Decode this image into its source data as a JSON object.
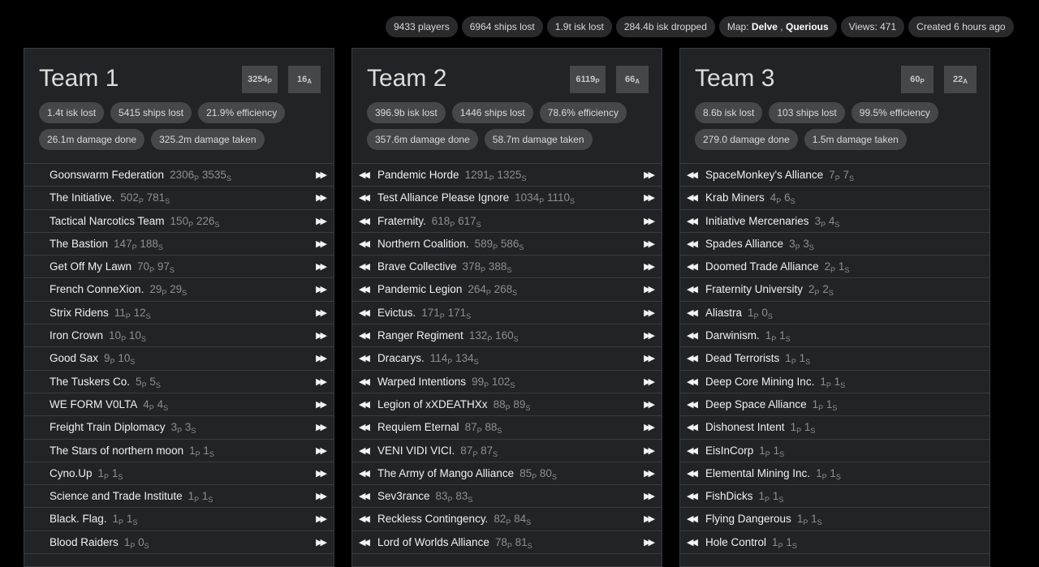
{
  "header": {
    "players": "9433 players",
    "ships_lost": "6964 ships lost",
    "isk_lost": "1.9t isk lost",
    "isk_dropped": "284.4b isk dropped",
    "map_label": "Map:",
    "map_system_1": "Delve",
    "map_sep": ",",
    "map_system_2": "Querious",
    "views": "Views: 471",
    "created": "Created 6 hours ago"
  },
  "teams": [
    {
      "title": "Team 1",
      "pilots": "3254",
      "pilot_sub": "P",
      "alliances": "16",
      "alliance_sub": "A",
      "stats": [
        "1.4t isk lost",
        "5415 ships lost",
        "21.9% efficiency",
        "26.1m damage done",
        "325.2m damage taken"
      ],
      "rows": [
        {
          "name": "Goonswarm Federation",
          "p": "2306",
          "s": "3535"
        },
        {
          "name": "The Initiative.",
          "p": "502",
          "s": "781"
        },
        {
          "name": "Tactical Narcotics Team",
          "p": "150",
          "s": "226"
        },
        {
          "name": "The Bastion",
          "p": "147",
          "s": "188"
        },
        {
          "name": "Get Off My Lawn",
          "p": "70",
          "s": "97"
        },
        {
          "name": "French ConneXion.",
          "p": "29",
          "s": "29"
        },
        {
          "name": "Strix Ridens",
          "p": "11",
          "s": "12"
        },
        {
          "name": "Iron Crown",
          "p": "10",
          "s": "10"
        },
        {
          "name": "Good Sax",
          "p": "9",
          "s": "10"
        },
        {
          "name": "The Tuskers Co.",
          "p": "5",
          "s": "5"
        },
        {
          "name": "WE FORM V0LTA",
          "p": "4",
          "s": "4"
        },
        {
          "name": "Freight Train Diplomacy",
          "p": "3",
          "s": "3"
        },
        {
          "name": "The Stars of northern moon",
          "p": "1",
          "s": "1"
        },
        {
          "name": "Cyno.Up",
          "p": "1",
          "s": "1"
        },
        {
          "name": "Science and Trade Institute",
          "p": "1",
          "s": "1"
        },
        {
          "name": "Black. Flag.",
          "p": "1",
          "s": "1"
        },
        {
          "name": "Blood Raiders",
          "p": "1",
          "s": "0"
        }
      ]
    },
    {
      "title": "Team 2",
      "pilots": "6119",
      "pilot_sub": "P",
      "alliances": "66",
      "alliance_sub": "A",
      "stats": [
        "396.9b isk lost",
        "1446 ships lost",
        "78.6% efficiency",
        "357.6m damage done",
        "58.7m damage taken"
      ],
      "rows": [
        {
          "name": "Pandemic Horde",
          "p": "1291",
          "s": "1325"
        },
        {
          "name": "Test Alliance Please Ignore",
          "p": "1034",
          "s": "1110"
        },
        {
          "name": "Fraternity.",
          "p": "618",
          "s": "617"
        },
        {
          "name": "Northern Coalition.",
          "p": "589",
          "s": "586"
        },
        {
          "name": "Brave Collective",
          "p": "378",
          "s": "388"
        },
        {
          "name": "Pandemic Legion",
          "p": "264",
          "s": "268"
        },
        {
          "name": "Evictus.",
          "p": "171",
          "s": "171"
        },
        {
          "name": "Ranger Regiment",
          "p": "132",
          "s": "160"
        },
        {
          "name": "Dracarys.",
          "p": "114",
          "s": "134"
        },
        {
          "name": "Warped Intentions",
          "p": "99",
          "s": "102"
        },
        {
          "name": "Legion of xXDEATHXx",
          "p": "88",
          "s": "89"
        },
        {
          "name": "Requiem Eternal",
          "p": "87",
          "s": "88"
        },
        {
          "name": "VENI VIDI VICI.",
          "p": "87",
          "s": "87"
        },
        {
          "name": "The Army of Mango Alliance",
          "p": "85",
          "s": "80"
        },
        {
          "name": "Sev3rance",
          "p": "83",
          "s": "83"
        },
        {
          "name": "Reckless Contingency.",
          "p": "82",
          "s": "84"
        },
        {
          "name": "Lord of Worlds Alliance",
          "p": "78",
          "s": "81"
        }
      ]
    },
    {
      "title": "Team 3",
      "pilots": "60",
      "pilot_sub": "P",
      "alliances": "22",
      "alliance_sub": "A",
      "stats": [
        "8.6b isk lost",
        "103 ships lost",
        "99.5% efficiency",
        "279.0 damage done",
        "1.5m damage taken"
      ],
      "rows": [
        {
          "name": "SpaceMonkey's Alliance",
          "p": "7",
          "s": "7"
        },
        {
          "name": "Krab Miners",
          "p": "4",
          "s": "6"
        },
        {
          "name": "Initiative Mercenaries",
          "p": "3",
          "s": "4"
        },
        {
          "name": "Spades Alliance",
          "p": "3",
          "s": "3"
        },
        {
          "name": "Doomed Trade Alliance",
          "p": "2",
          "s": "1"
        },
        {
          "name": "Fraternity University",
          "p": "2",
          "s": "2"
        },
        {
          "name": "Aliastra",
          "p": "1",
          "s": "0"
        },
        {
          "name": "Darwinism.",
          "p": "1",
          "s": "1"
        },
        {
          "name": "Dead Terrorists",
          "p": "1",
          "s": "1"
        },
        {
          "name": "Deep Core Mining Inc.",
          "p": "1",
          "s": "1"
        },
        {
          "name": "Deep Space Alliance",
          "p": "1",
          "s": "1"
        },
        {
          "name": "Dishonest Intent",
          "p": "1",
          "s": "1"
        },
        {
          "name": "EisInCorp",
          "p": "1",
          "s": "1"
        },
        {
          "name": "Elemental Mining Inc.",
          "p": "1",
          "s": "1"
        },
        {
          "name": "FishDicks",
          "p": "1",
          "s": "1"
        },
        {
          "name": "Flying Dangerous",
          "p": "1",
          "s": "1"
        },
        {
          "name": "Hole Control",
          "p": "1",
          "s": "1"
        }
      ]
    }
  ],
  "labels": {
    "pilot_unit": "P",
    "ship_unit": "S"
  },
  "icons": {
    "move_left": "double-arrow-left-icon",
    "move_right": "double-arrow-right-icon"
  }
}
